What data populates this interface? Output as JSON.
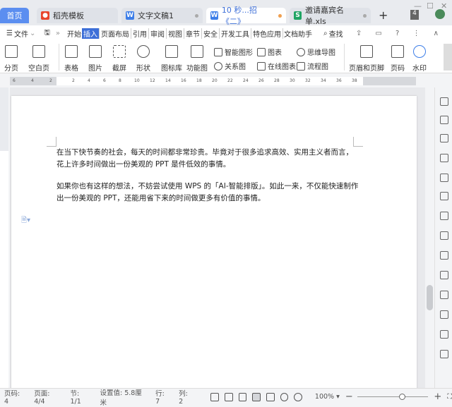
{
  "tabs": [
    {
      "label": "首页"
    },
    {
      "label": "稻壳模板",
      "icon": "daoke-icon"
    },
    {
      "label": "文字文稿1",
      "icon": "W"
    },
    {
      "label": "10 秒...招《二》",
      "icon": "W"
    },
    {
      "label": "邀请嘉宾名单.xls",
      "icon": "S"
    }
  ],
  "tab_count": "4",
  "menu": {
    "file": "文件",
    "items": [
      "开始",
      "插入",
      "页面布局",
      "引用",
      "审阅",
      "视图",
      "章节",
      "安全",
      "开发工具",
      "特色应用",
      "文档助手"
    ],
    "selected": "插入",
    "search": "查找"
  },
  "ribbon": {
    "big": [
      "分页",
      "空白页",
      "表格",
      "图片",
      "截屏",
      "形状",
      "图标库",
      "功能图",
      "页眉和页脚",
      "页码",
      "水印"
    ],
    "small": [
      "智能图形",
      "关系图",
      "图表",
      "在线图表",
      "思维导图",
      "流程图"
    ]
  },
  "ruler_ticks": [
    "6",
    "4",
    "2",
    "2",
    "4",
    "6",
    "8",
    "10",
    "12",
    "14",
    "16",
    "18",
    "20",
    "22",
    "24",
    "26",
    "28",
    "30",
    "32",
    "34",
    "36",
    "38"
  ],
  "document": {
    "paragraphs": [
      "在当下快节奏的社会，每天的时间都非常珍贵。毕竟对于很多追求高效、实用主义者而言，花上许多时间做出一份美观的 PPT 是件低效的事情。",
      "如果你也有这样的想法，不妨尝试使用 WPS 的「AI-智能排版」。如此一来，不仅能快速制作出一份美观的 PPT，还能用省下来的时间做更多有价值的事情。"
    ]
  },
  "status": {
    "page_num": "页码: 4",
    "pages": "页面: 4/4",
    "section": "节: 1/1",
    "setting": "设置值: 5.8厘米",
    "row": "行: 7",
    "col": "列: 2",
    "zoom": "100%",
    "zoom_value": 100
  }
}
